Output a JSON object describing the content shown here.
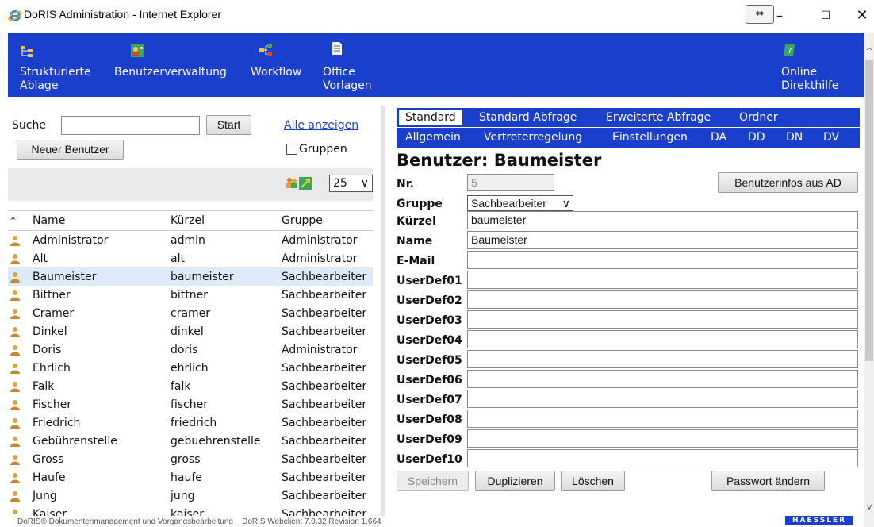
{
  "window": {
    "title": "DoRIS Administration - Internet Explorer",
    "minimize": "–",
    "maximize": "☐",
    "close": "✕",
    "compat": "⇔"
  },
  "nav": {
    "items": [
      {
        "line1": "Strukturierte",
        "line2": "Ablage",
        "icon": "folder-tree-icon"
      },
      {
        "line1": "Benutzerverwaltung",
        "line2": "",
        "icon": "user-management-icon"
      },
      {
        "line1": "Workflow",
        "line2": "",
        "icon": "workflow-icon"
      },
      {
        "line1": "Office",
        "line2": "Vorlagen",
        "icon": "document-icon"
      },
      {
        "line1": "Online",
        "line2": "Direkthilfe",
        "icon": "help-icon"
      }
    ]
  },
  "left": {
    "search_label": "Suche",
    "search_value": "",
    "start_label": "Start",
    "show_all_label": "Alle anzeigen",
    "new_user_label": "Neuer Benutzer",
    "groups_label": "Gruppen",
    "page_size": "25",
    "columns": [
      "*",
      "Name",
      "Kürzel",
      "Gruppe"
    ],
    "rows": [
      {
        "name": "Administrator",
        "short": "admin",
        "group": "Administrator"
      },
      {
        "name": "Alt",
        "short": "alt",
        "group": "Administrator"
      },
      {
        "name": "Baumeister",
        "short": "baumeister",
        "group": "Sachbearbeiter",
        "selected": true
      },
      {
        "name": "Bittner",
        "short": "bittner",
        "group": "Sachbearbeiter"
      },
      {
        "name": "Cramer",
        "short": "cramer",
        "group": "Sachbearbeiter"
      },
      {
        "name": "Dinkel",
        "short": "dinkel",
        "group": "Sachbearbeiter"
      },
      {
        "name": "Doris",
        "short": "doris",
        "group": "Administrator"
      },
      {
        "name": "Ehrlich",
        "short": "ehrlich",
        "group": "Sachbearbeiter"
      },
      {
        "name": "Falk",
        "short": "falk",
        "group": "Sachbearbeiter"
      },
      {
        "name": "Fischer",
        "short": "fischer",
        "group": "Sachbearbeiter"
      },
      {
        "name": "Friedrich",
        "short": "friedrich",
        "group": "Sachbearbeiter"
      },
      {
        "name": "Gebührenstelle",
        "short": "gebuehrenstelle",
        "group": "Sachbearbeiter"
      },
      {
        "name": "Gross",
        "short": "gross",
        "group": "Sachbearbeiter"
      },
      {
        "name": "Haufe",
        "short": "haufe",
        "group": "Sachbearbeiter"
      },
      {
        "name": "Jung",
        "short": "jung",
        "group": "Sachbearbeiter"
      },
      {
        "name": "Kaiser",
        "short": "kaiser",
        "group": "Sachbearbeiter"
      }
    ]
  },
  "right": {
    "tabs_row1": [
      "Standard",
      "Standard Abfrage",
      "Erweiterte Abfrage",
      "Ordner"
    ],
    "tabs_row2": [
      "Allgemein",
      "Vertreterregelung",
      "Einstellungen",
      "DA",
      "DD",
      "DN",
      "DV"
    ],
    "title": "Benutzer: Baumeister",
    "nr_label": "Nr.",
    "nr_value": "5",
    "ad_button": "Benutzerinfos aus AD",
    "group_label": "Gruppe",
    "group_value": "Sachbearbeiter",
    "fields": [
      {
        "label": "Kürzel",
        "value": "baumeister"
      },
      {
        "label": "Name",
        "value": "Baumeister"
      },
      {
        "label": "E-Mail",
        "value": ""
      },
      {
        "label": "UserDef01",
        "value": ""
      },
      {
        "label": "UserDef02",
        "value": ""
      },
      {
        "label": "UserDef03",
        "value": ""
      },
      {
        "label": "UserDef04",
        "value": ""
      },
      {
        "label": "UserDef05",
        "value": ""
      },
      {
        "label": "UserDef06",
        "value": ""
      },
      {
        "label": "UserDef07",
        "value": ""
      },
      {
        "label": "UserDef08",
        "value": ""
      },
      {
        "label": "UserDef09",
        "value": ""
      },
      {
        "label": "UserDef10",
        "value": ""
      }
    ],
    "save_label": "Speichern",
    "duplicate_label": "Duplizieren",
    "delete_label": "Löschen",
    "password_label": "Passwort ändern"
  },
  "footer": {
    "text": "DoRIS® Dokumentenmanagement und Vorgangsbearbeitung _ DoRIS Webclient 7.0.32 Revision 1.664",
    "brand": "HAESSLER"
  },
  "colors": {
    "accent": "#1a3fcc",
    "selected_row": "#ddeafa"
  }
}
